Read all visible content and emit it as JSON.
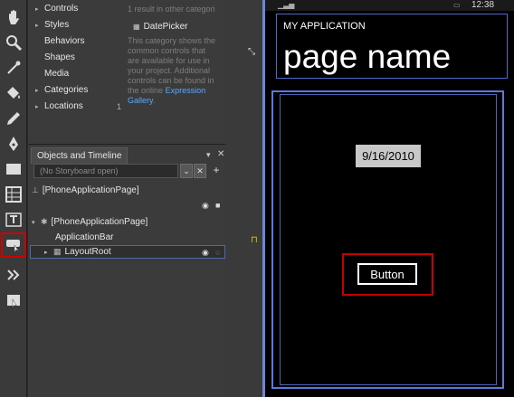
{
  "assets": {
    "categories": [
      {
        "label": "Controls",
        "count": ""
      },
      {
        "label": "Styles",
        "count": ""
      },
      {
        "label": "Behaviors",
        "count": ""
      },
      {
        "label": "Shapes",
        "count": ""
      },
      {
        "label": "Media",
        "count": ""
      },
      {
        "label": "Categories",
        "count": ""
      },
      {
        "label": "Locations",
        "count": "1"
      }
    ],
    "result_text": "1 result in other categori",
    "result_item": "DatePicker",
    "desc_lines": [
      "This category shows the",
      "common controls that",
      "are available for use in",
      "your project. Additional",
      "controls can be found in",
      "the online"
    ],
    "gallery_link_1": "Expression",
    "gallery_link_2": "Gallery",
    "gallery_end": "."
  },
  "objects": {
    "tab_label": "Objects and Timeline",
    "storyboard": "(No Storyboard open)",
    "root_label": "[PhoneApplicationPage]",
    "page_label": "[PhoneApplicationPage]",
    "appbar_label": "ApplicationBar",
    "layoutroot_label": "LayoutRoot"
  },
  "phone": {
    "time": "12:38",
    "app_title": "MY APPLICATION",
    "page_name": "page name",
    "date": "9/16/2010",
    "button": "Button"
  },
  "colors": {
    "accent": "#5b79d9",
    "highlight": "#c40000",
    "link": "#5aa9ff"
  }
}
